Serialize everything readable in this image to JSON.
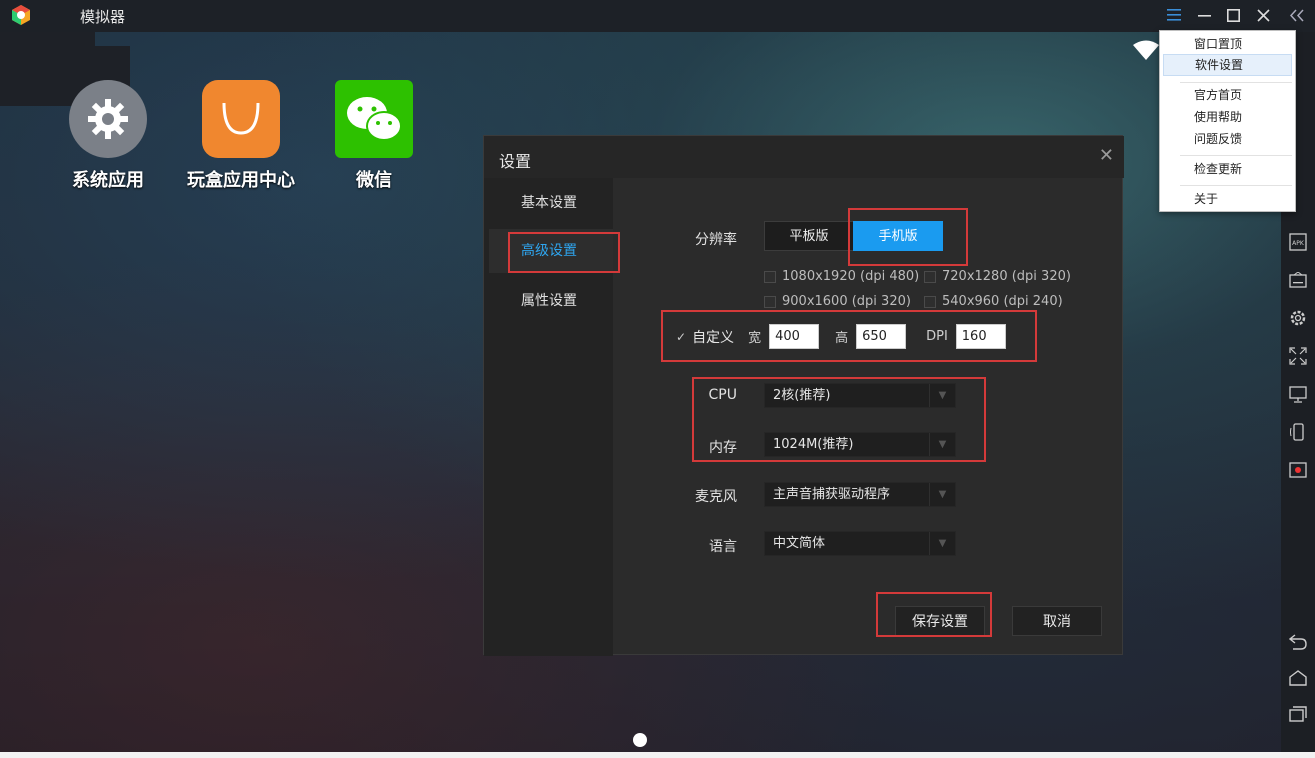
{
  "window": {
    "title": "模拟器"
  },
  "desktop": {
    "icons": [
      {
        "label": "系统应用"
      },
      {
        "label": "玩盒应用中心"
      },
      {
        "label": "微信"
      }
    ]
  },
  "context_menu": {
    "items": [
      "窗口置顶",
      "软件设置",
      "官方首页",
      "使用帮助",
      "问题反馈",
      "检查更新",
      "关于"
    ]
  },
  "dialog": {
    "title": "设置",
    "nav": [
      "基本设置",
      "高级设置",
      "属性设置"
    ],
    "active_nav": "高级设置",
    "resolution_label": "分辨率",
    "mode_buttons": [
      "平板版",
      "手机版"
    ],
    "active_mode": "手机版",
    "resolution_options": [
      "1080x1920 (dpi 480)",
      "720x1280 (dpi 320)",
      "900x1600 (dpi 320)",
      "540x960 (dpi 240)"
    ],
    "custom": {
      "check_mark": "✓",
      "label": "自定义",
      "width_label": "宽",
      "width_value": "400",
      "height_label": "高",
      "height_value": "650",
      "dpi_label": "DPI",
      "dpi_value": "160"
    },
    "cpu_label": "CPU",
    "cpu_value": "2核(推荐)",
    "memory_label": "内存",
    "memory_value": "1024M(推荐)",
    "mic_label": "麦克风",
    "mic_value": "主声音捕获驱动程序",
    "language_label": "语言",
    "language_value": "中文简体",
    "save_label": "保存设置",
    "cancel_label": "取消"
  },
  "colors": {
    "accent": "#1a9bf0",
    "highlight_box": "#d43a3a",
    "dialog_bg": "#2b2b2b"
  },
  "icons": {
    "titlebar": [
      "menu-icon",
      "minimize-icon",
      "maximize-icon",
      "close-icon",
      "collapse-icon"
    ],
    "right_bar": [
      "apk-install-icon",
      "keyboard-icon",
      "settings-gear-icon",
      "fullscreen-icon",
      "screen-icon",
      "rotate-icon",
      "record-icon",
      "back-icon",
      "home-icon",
      "recent-apps-icon"
    ]
  }
}
